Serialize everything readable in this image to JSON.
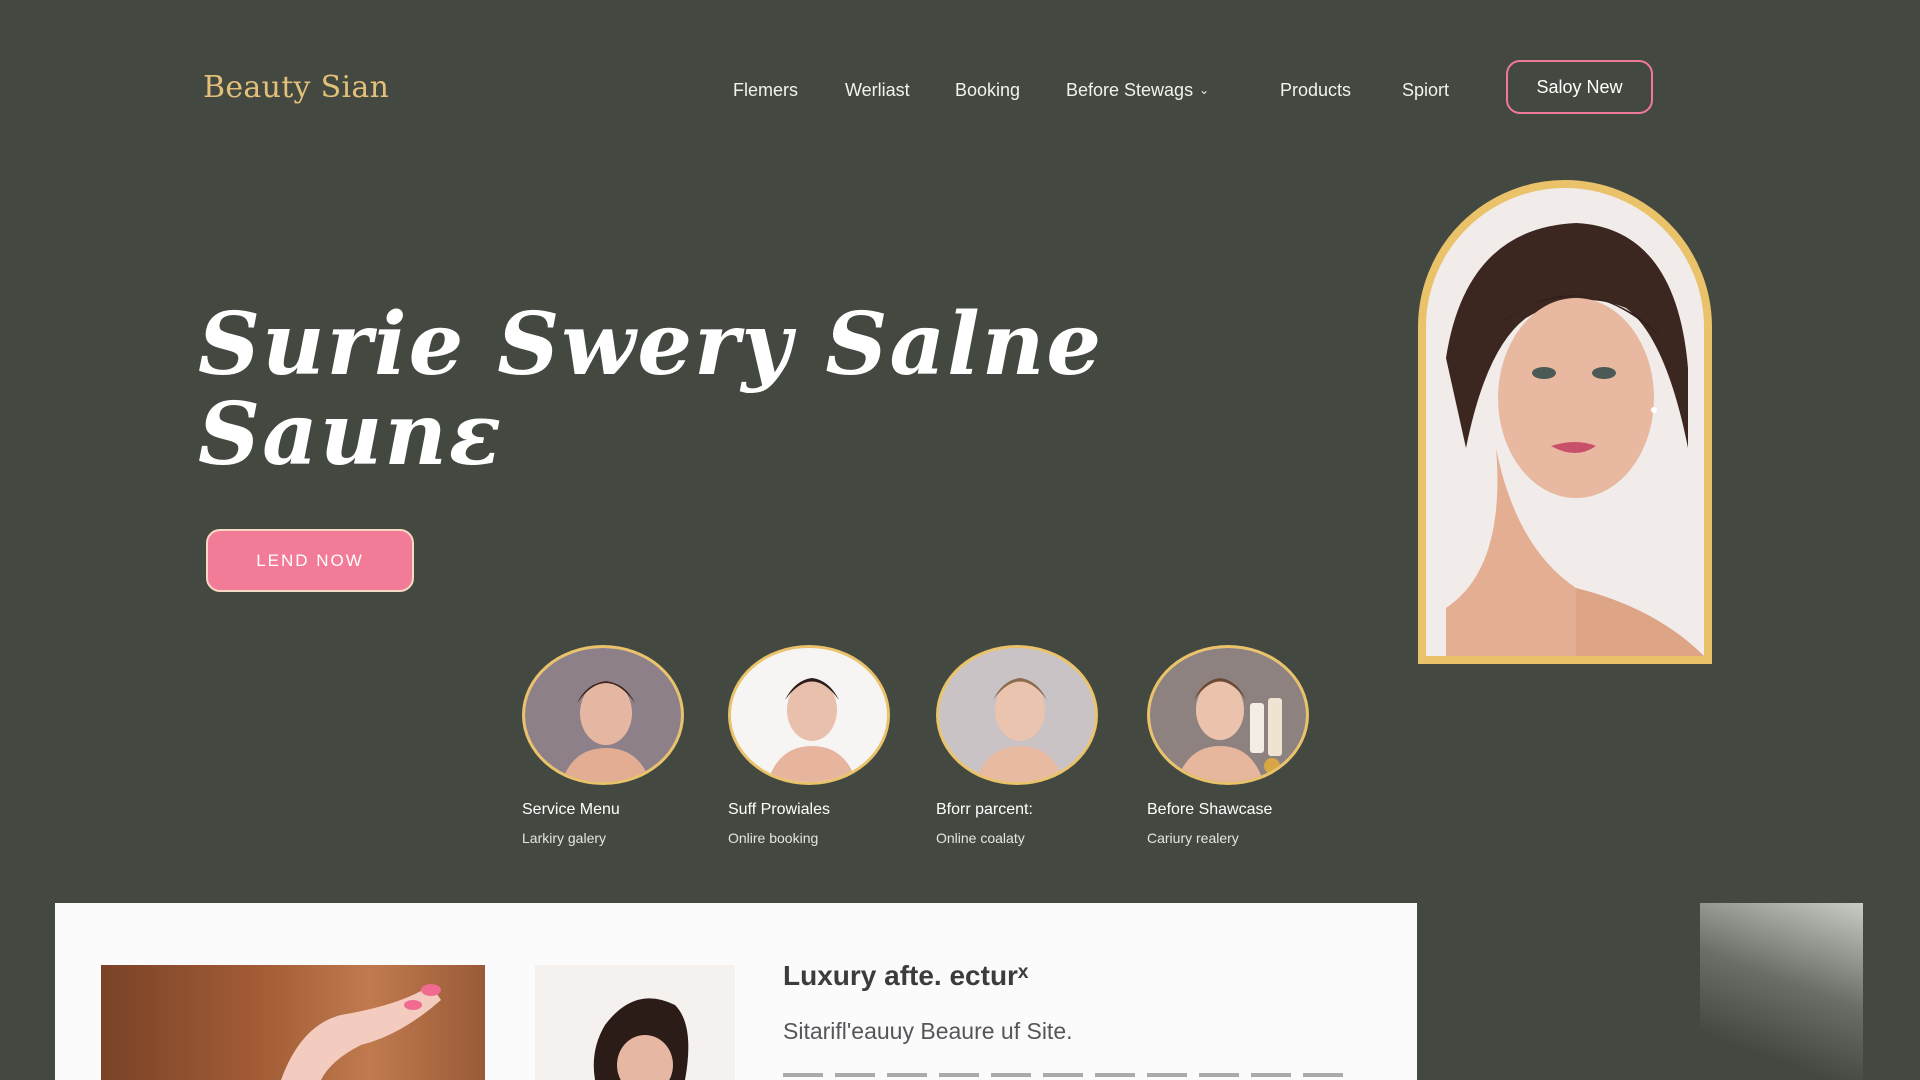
{
  "header": {
    "logo": "Beauty Sian",
    "nav": [
      {
        "label": "Flemers",
        "name": "nav-flemers"
      },
      {
        "label": "Werliast",
        "name": "nav-werliast"
      },
      {
        "label": "Booking",
        "name": "nav-booking"
      },
      {
        "label": "Before Stewags",
        "name": "nav-before-stewags",
        "dropdown": true
      },
      {
        "label": "Products",
        "name": "nav-products"
      },
      {
        "label": "Spiort",
        "name": "nav-spiort"
      }
    ],
    "cta_outline": "Saloy New"
  },
  "hero": {
    "title_line1": "Surie Swery Salne",
    "title_line2": "Saunε",
    "cta": "LEND NOW"
  },
  "services": [
    {
      "title": "Service Menu",
      "sub": "Larkiry galery"
    },
    {
      "title": "Suff Prowiales",
      "sub": "Onlire booking"
    },
    {
      "title": "Bforr parcent:",
      "sub": "Online coalaty"
    },
    {
      "title": "Before Shawcase",
      "sub": "Cariury realery"
    }
  ],
  "feature": {
    "heading": "Luxury afte. ecturˣ",
    "subheading": "Sitarifl'eauuy Beaure uf Site."
  },
  "colors": {
    "background": "#434840",
    "accent_gold": "#e9c26a",
    "accent_pink": "#f27c98",
    "logo": "#e3c07a"
  },
  "icons": {
    "dropdown": "chevron-down-icon"
  }
}
